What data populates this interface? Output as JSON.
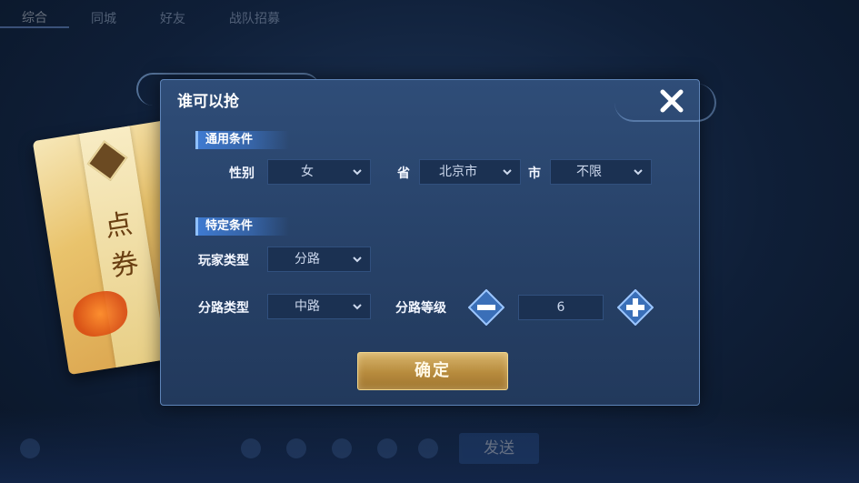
{
  "background": {
    "tabs": [
      "综合",
      "同城",
      "好友",
      "战队招募"
    ],
    "send_label": "发送"
  },
  "envelope": {
    "text": "点券"
  },
  "dialog": {
    "title": "谁可以抢",
    "general_section": "通用条件",
    "gender_label": "性别",
    "gender_value": "女",
    "province_label": "省",
    "province_value": "北京市",
    "city_label": "市",
    "city_value": "不限",
    "specific_section": "特定条件",
    "player_type_label": "玩家类型",
    "player_type_value": "分路",
    "lane_type_label": "分路类型",
    "lane_type_value": "中路",
    "lane_level_label": "分路等级",
    "lane_level_value": "6",
    "confirm_label": "确定"
  },
  "colors": {
    "accent_gold": "#d8b56c",
    "section_blue": "#3f7ad0",
    "panel": "#2f4d78"
  },
  "icons": {
    "close": "close-icon",
    "minus": "minus-icon",
    "plus": "plus-icon",
    "dropdown": "chevron-down-icon"
  }
}
